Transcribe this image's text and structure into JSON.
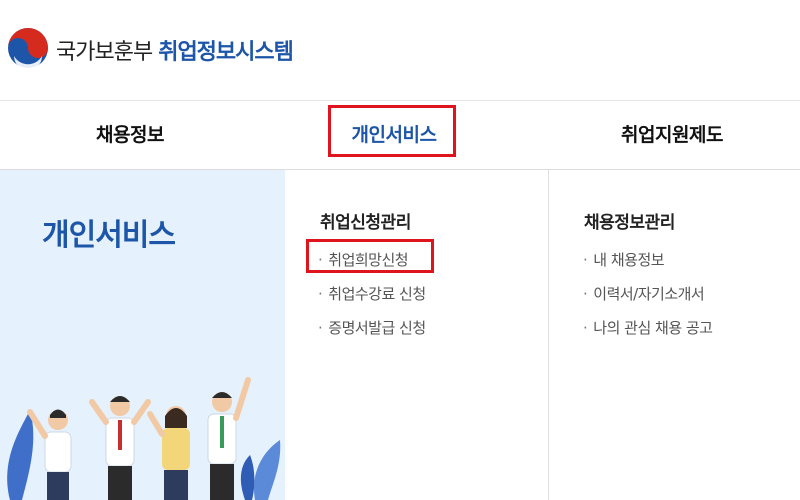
{
  "header": {
    "ministry": "국가보훈부",
    "system": "취업정보시스템"
  },
  "nav": {
    "items": [
      {
        "label": "채용정보"
      },
      {
        "label": "개인서비스"
      },
      {
        "label": "취업지원제도"
      }
    ],
    "active_index": 1
  },
  "panel": {
    "title": "개인서비스"
  },
  "menu": {
    "columns": [
      {
        "title": "취업신청관리",
        "items": [
          {
            "label": "취업희망신청"
          },
          {
            "label": "취업수강료 신청"
          },
          {
            "label": "증명서발급 신청"
          }
        ]
      },
      {
        "title": "채용정보관리",
        "items": [
          {
            "label": "내 채용정보"
          },
          {
            "label": "이력서/자기소개서"
          },
          {
            "label": "나의 관심 채용 공고"
          }
        ]
      }
    ]
  },
  "colors": {
    "brand_blue": "#1d56a8",
    "brand_red": "#d52b1e",
    "highlight_red": "#e0141c",
    "panel_bg": "#e5f1fc"
  },
  "icons": {
    "logo": "taegeuk-logo"
  }
}
